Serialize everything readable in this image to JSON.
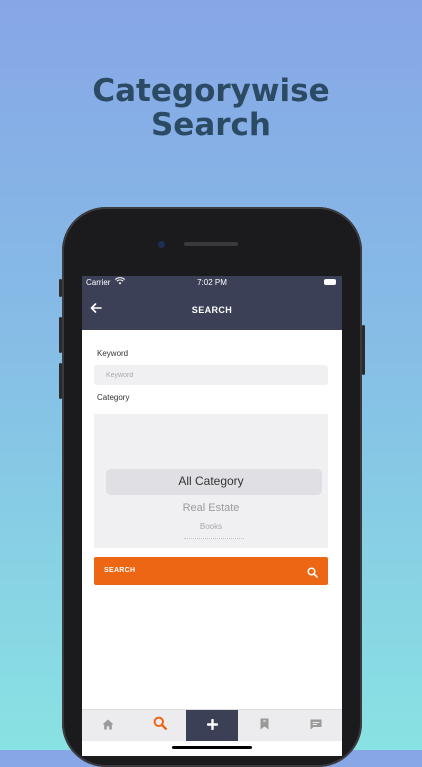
{
  "headline": {
    "line1": "Categorywise",
    "line2": "Search"
  },
  "status_bar": {
    "carrier": "Carrier",
    "time": "7:02 PM"
  },
  "nav": {
    "title": "SEARCH",
    "back_icon": "arrow-left-icon"
  },
  "form": {
    "keyword_label": "Keyword",
    "keyword_placeholder": "Keyword",
    "keyword_value": "",
    "category_label": "Category",
    "category_options": [
      "All Category",
      "Real Estate",
      "Books"
    ],
    "category_selected": "All Category"
  },
  "search_button": {
    "label": "SEARCH",
    "icon": "search-icon"
  },
  "tabs": [
    {
      "icon": "home-icon",
      "active": false
    },
    {
      "icon": "search-icon",
      "active": false
    },
    {
      "icon": "plus-icon",
      "active": true
    },
    {
      "icon": "bookmark-icon",
      "active": false
    },
    {
      "icon": "chat-icon",
      "active": false
    }
  ],
  "colors": {
    "headline": "#2b4a63",
    "navbar": "#3b4057",
    "accent": "#ec6613",
    "tab_icon": "#9a9a9a"
  }
}
